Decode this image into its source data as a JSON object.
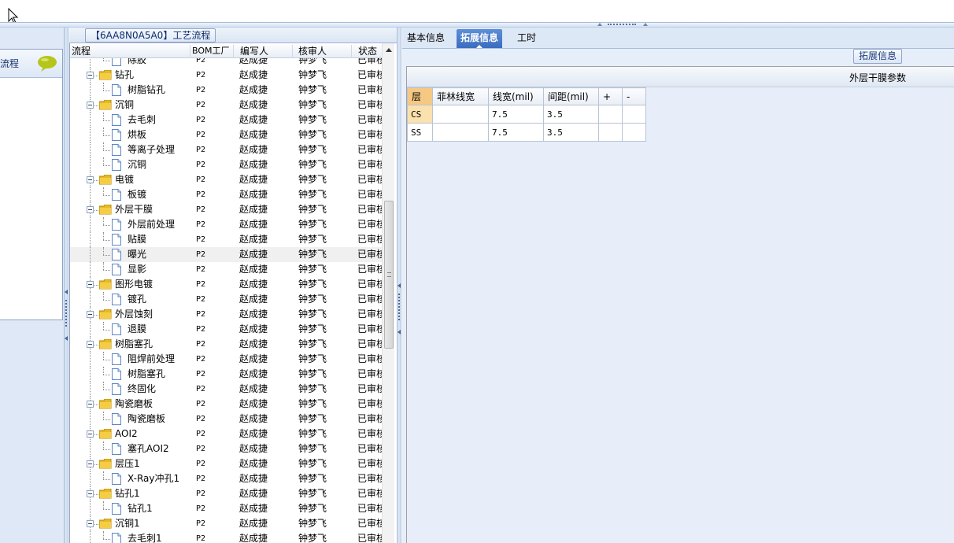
{
  "left_panel": {
    "label": "流程"
  },
  "process_panel": {
    "title": "【6AA8N0A5A0】工艺流程",
    "columns": [
      "流程",
      "BOM工厂",
      "编写人",
      "核审人",
      "状态"
    ],
    "rows": [
      {
        "name": "除胶",
        "level": 2,
        "type": "file",
        "bom": "P2",
        "writer": "赵成捷",
        "checker": "钟梦飞",
        "status": "已审核"
      },
      {
        "name": "钻孔",
        "level": 1,
        "type": "folder",
        "bom": "P2",
        "writer": "赵成捷",
        "checker": "钟梦飞",
        "status": "已审核"
      },
      {
        "name": "树脂钻孔",
        "level": 2,
        "type": "file",
        "bom": "P2",
        "writer": "赵成捷",
        "checker": "钟梦飞",
        "status": "已审核"
      },
      {
        "name": "沉铜",
        "level": 1,
        "type": "folder",
        "bom": "P2",
        "writer": "赵成捷",
        "checker": "钟梦飞",
        "status": "已审核"
      },
      {
        "name": "去毛刺",
        "level": 2,
        "type": "file",
        "bom": "P2",
        "writer": "赵成捷",
        "checker": "钟梦飞",
        "status": "已审核"
      },
      {
        "name": "烘板",
        "level": 2,
        "type": "file",
        "bom": "P2",
        "writer": "赵成捷",
        "checker": "钟梦飞",
        "status": "已审核"
      },
      {
        "name": "等离子处理",
        "level": 2,
        "type": "file",
        "bom": "P2",
        "writer": "赵成捷",
        "checker": "钟梦飞",
        "status": "已审核"
      },
      {
        "name": "沉铜",
        "level": 2,
        "type": "file",
        "bom": "P2",
        "writer": "赵成捷",
        "checker": "钟梦飞",
        "status": "已审核"
      },
      {
        "name": "电镀",
        "level": 1,
        "type": "folder",
        "bom": "P2",
        "writer": "赵成捷",
        "checker": "钟梦飞",
        "status": "已审核"
      },
      {
        "name": "板镀",
        "level": 2,
        "type": "file",
        "bom": "P2",
        "writer": "赵成捷",
        "checker": "钟梦飞",
        "status": "已审核"
      },
      {
        "name": "外层干膜",
        "level": 1,
        "type": "folder",
        "bom": "P2",
        "writer": "赵成捷",
        "checker": "钟梦飞",
        "status": "已审核"
      },
      {
        "name": "外层前处理",
        "level": 2,
        "type": "file",
        "bom": "P2",
        "writer": "赵成捷",
        "checker": "钟梦飞",
        "status": "已审核"
      },
      {
        "name": "贴膜",
        "level": 2,
        "type": "file",
        "bom": "P2",
        "writer": "赵成捷",
        "checker": "钟梦飞",
        "status": "已审核"
      },
      {
        "name": "曝光",
        "level": 2,
        "type": "file",
        "bom": "P2",
        "writer": "赵成捷",
        "checker": "钟梦飞",
        "status": "已审核",
        "selected": true
      },
      {
        "name": "显影",
        "level": 2,
        "type": "file",
        "bom": "P2",
        "writer": "赵成捷",
        "checker": "钟梦飞",
        "status": "已审核"
      },
      {
        "name": "图形电镀",
        "level": 1,
        "type": "folder",
        "bom": "P2",
        "writer": "赵成捷",
        "checker": "钟梦飞",
        "status": "已审核"
      },
      {
        "name": "镀孔",
        "level": 2,
        "type": "file",
        "bom": "P2",
        "writer": "赵成捷",
        "checker": "钟梦飞",
        "status": "已审核"
      },
      {
        "name": "外层蚀刻",
        "level": 1,
        "type": "folder",
        "bom": "P2",
        "writer": "赵成捷",
        "checker": "钟梦飞",
        "status": "已审核"
      },
      {
        "name": "退膜",
        "level": 2,
        "type": "file",
        "bom": "P2",
        "writer": "赵成捷",
        "checker": "钟梦飞",
        "status": "已审核"
      },
      {
        "name": "树脂塞孔",
        "level": 1,
        "type": "folder",
        "bom": "P2",
        "writer": "赵成捷",
        "checker": "钟梦飞",
        "status": "已审核"
      },
      {
        "name": "阻焊前处理",
        "level": 2,
        "type": "file",
        "bom": "P2",
        "writer": "赵成捷",
        "checker": "钟梦飞",
        "status": "已审核"
      },
      {
        "name": "树脂塞孔",
        "level": 2,
        "type": "file",
        "bom": "P2",
        "writer": "赵成捷",
        "checker": "钟梦飞",
        "status": "已审核"
      },
      {
        "name": "终固化",
        "level": 2,
        "type": "file",
        "bom": "P2",
        "writer": "赵成捷",
        "checker": "钟梦飞",
        "status": "已审核"
      },
      {
        "name": "陶瓷磨板",
        "level": 1,
        "type": "folder",
        "bom": "P2",
        "writer": "赵成捷",
        "checker": "钟梦飞",
        "status": "已审核"
      },
      {
        "name": "陶瓷磨板",
        "level": 2,
        "type": "file",
        "bom": "P2",
        "writer": "赵成捷",
        "checker": "钟梦飞",
        "status": "已审核"
      },
      {
        "name": "AOI2",
        "level": 1,
        "type": "folder",
        "bom": "P2",
        "writer": "赵成捷",
        "checker": "钟梦飞",
        "status": "已审核"
      },
      {
        "name": "塞孔AOI2",
        "level": 2,
        "type": "file",
        "bom": "P2",
        "writer": "赵成捷",
        "checker": "钟梦飞",
        "status": "已审核"
      },
      {
        "name": "层压1",
        "level": 1,
        "type": "folder",
        "bom": "P2",
        "writer": "赵成捷",
        "checker": "钟梦飞",
        "status": "已审核"
      },
      {
        "name": "X-Ray冲孔1",
        "level": 2,
        "type": "file",
        "bom": "P2",
        "writer": "赵成捷",
        "checker": "钟梦飞",
        "status": "已审核"
      },
      {
        "name": "钻孔1",
        "level": 1,
        "type": "folder",
        "bom": "P2",
        "writer": "赵成捷",
        "checker": "钟梦飞",
        "status": "已审核"
      },
      {
        "name": "钻孔1",
        "level": 2,
        "type": "file",
        "bom": "P2",
        "writer": "赵成捷",
        "checker": "钟梦飞",
        "status": "已审核"
      },
      {
        "name": "沉铜1",
        "level": 1,
        "type": "folder",
        "bom": "P2",
        "writer": "赵成捷",
        "checker": "钟梦飞",
        "status": "已审核"
      },
      {
        "name": "去毛刺1",
        "level": 2,
        "type": "file",
        "bom": "P2",
        "writer": "赵成捷",
        "checker": "钟梦飞",
        "status": "已审核"
      }
    ]
  },
  "right_panel": {
    "tabs": [
      "基本信息",
      "拓展信息",
      "工时"
    ],
    "active_tab": 1,
    "ext_label": "拓展信息",
    "section_title": "外层干膜参数",
    "table": {
      "headers": [
        "层",
        "菲林线宽",
        "线宽(mil)",
        "间距(mil)",
        "+",
        "-"
      ],
      "rows": [
        [
          "CS",
          "",
          "7.5",
          "3.5",
          "",
          ""
        ],
        [
          "SS",
          "",
          "7.5",
          "3.5",
          "",
          ""
        ]
      ]
    }
  },
  "colors": {
    "active_tab": "#3b6cc0",
    "layer_header": "#f5c983",
    "selected_row": "#f0f0f0",
    "panel_bg": "#dde8f6"
  }
}
